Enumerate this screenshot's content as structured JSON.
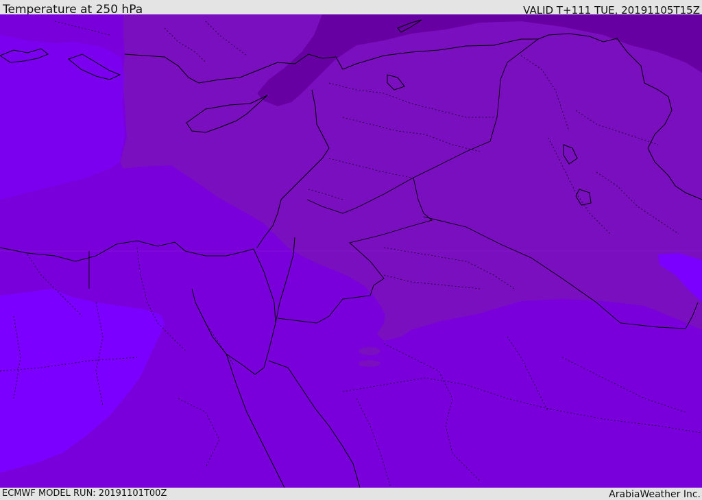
{
  "header": {
    "title": "Temperature at 250 hPa",
    "valid_time": "VALID T+111 TUE, 20191105T15Z"
  },
  "footer": {
    "model_run": "ECMWF MODEL RUN: 20191101T00Z",
    "credit": "ArabiaWeather Inc."
  },
  "map": {
    "field": "temperature",
    "level": "250 hPa",
    "fill_colors": {
      "light_violet": "#7b00ff",
      "violet": "#7a00db",
      "purple": "#7a0fbf",
      "dark_purple": "#6600a3",
      "pale_band": "#8a1ad0"
    },
    "border_color": "#000000"
  }
}
